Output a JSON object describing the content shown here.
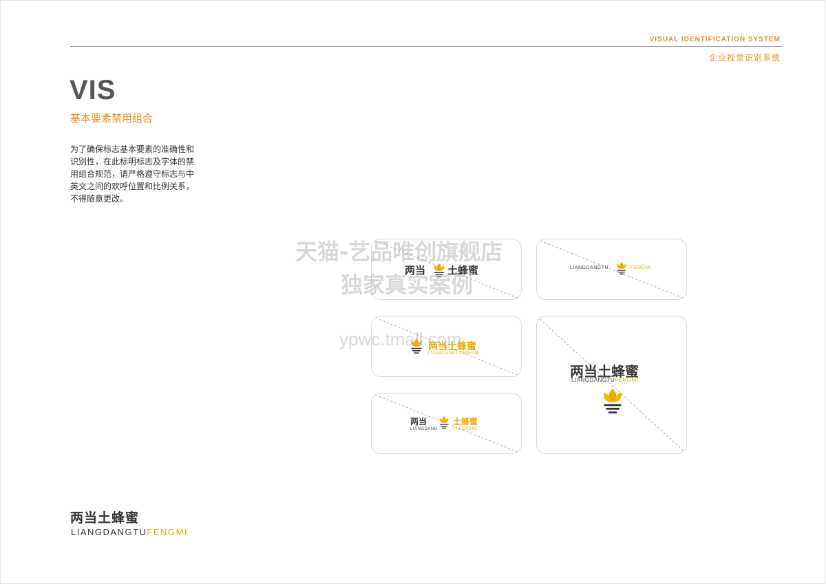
{
  "header": {
    "system_en": "VISUAL IDENTIFICATION SYSTEM",
    "system_cn": "企业视觉识别系统"
  },
  "section": {
    "title": "VIS",
    "subtitle": "基本要素禁用组合",
    "description": "为了确保标志基本要素的准确性和识别性，在此标明标志及字体的禁用组合规范，请严格遵守标志与中英文之间的欢呼位置和比例关系，不得随意更改。"
  },
  "brand": {
    "name_cn": "两当土蜂蜜",
    "name_cn_part1": "两当",
    "name_cn_part2": "土蜂蜜",
    "name_en_dark": "LIANGDANGTU",
    "name_en_yellow": "FENGMI",
    "name_en_short_dark": "LIANGDANG",
    "name_en_short_yellow": "TUFENGMI",
    "colors": {
      "primary": "#f2a900",
      "accent": "#ef8a1e",
      "text": "#3c3c3c"
    }
  },
  "watermark": {
    "line1": "天猫-艺品唯创旗舰店",
    "line2": "独家真实案例",
    "url": "ypwc.tmall.com"
  },
  "examples": [
    {
      "id": "a",
      "icon": "honey-flower-icon"
    },
    {
      "id": "b",
      "icon": "honey-flower-icon"
    },
    {
      "id": "c",
      "icon": "honey-flower-icon"
    },
    {
      "id": "d",
      "icon": "honey-flower-icon"
    },
    {
      "id": "e",
      "icon": "honey-flower-icon"
    }
  ]
}
